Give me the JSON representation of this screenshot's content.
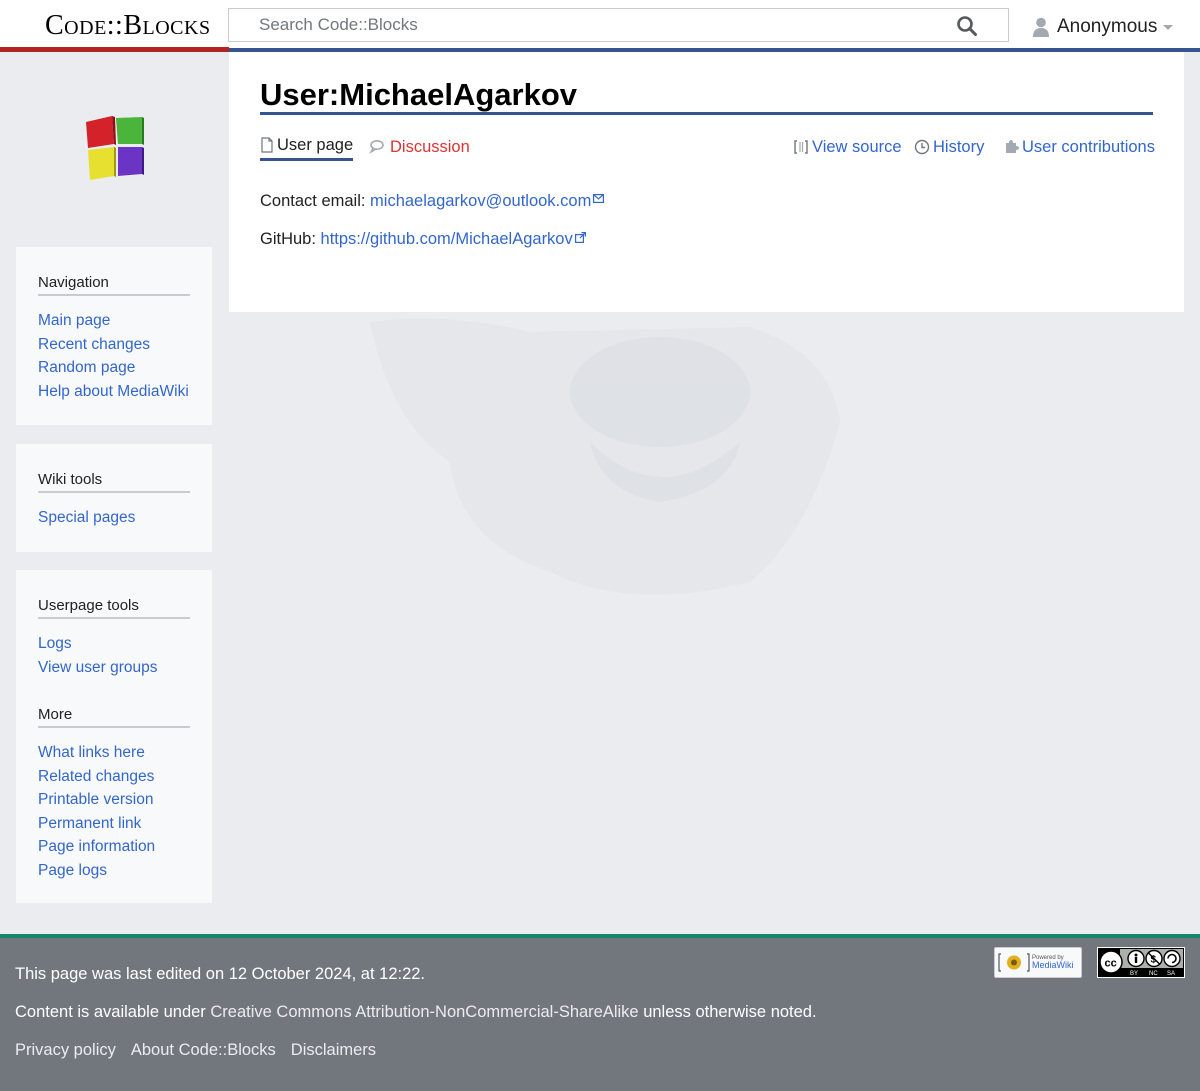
{
  "header": {
    "logo_text": "Code::Blocks",
    "search_placeholder": "Search Code::Blocks",
    "user_name": "Anonymous"
  },
  "sidebar": {
    "navigation": {
      "heading": "Navigation",
      "items": [
        "Main page",
        "Recent changes",
        "Random page",
        "Help about MediaWiki"
      ]
    },
    "wiki_tools": {
      "heading": "Wiki tools",
      "items": [
        "Special pages"
      ]
    },
    "userpage_tools": {
      "heading": "Userpage tools",
      "items": [
        "Logs",
        "View user groups"
      ]
    },
    "more": {
      "heading": "More",
      "items": [
        "What links here",
        "Related changes",
        "Printable version",
        "Permanent link",
        "Page information",
        "Page logs"
      ]
    }
  },
  "content": {
    "title": "User:MichaelAgarkov",
    "tabs": {
      "user_page": "User page",
      "discussion": "Discussion",
      "view_source": "View source",
      "history": "History",
      "user_contributions": "User contributions"
    },
    "email_label": "Contact email: ",
    "email_value": "michaelagarkov@outlook.com",
    "github_label": "GitHub: ",
    "github_value": "https://github.com/MichaelAgarkov"
  },
  "footer": {
    "last_edited": "This page was last edited on 12 October 2024, at 12:22.",
    "license_prefix": "Content is available under ",
    "license_link": "Creative Commons Attribution-NonCommercial-ShareAlike",
    "license_suffix": " unless otherwise noted.",
    "links": [
      "Privacy policy",
      "About Code::Blocks",
      "Disclaimers"
    ],
    "badges": {
      "mediawiki_line1": "Powered by",
      "mediawiki_line2": "MediaWiki",
      "cc_terms": [
        "BY",
        "NC",
        "SA"
      ]
    }
  },
  "colors": {
    "accent_blue": "#36548f",
    "accent_red": "#b32424",
    "link": "#3366cc",
    "new_link": "#dd3333",
    "footer_bg": "#72777d",
    "footer_accent": "#14866d"
  }
}
